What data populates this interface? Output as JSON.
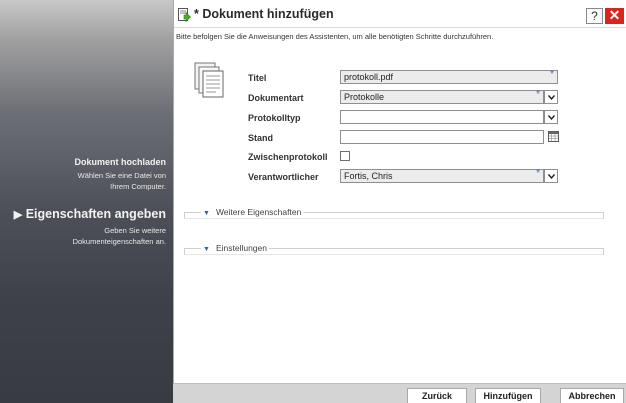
{
  "sidebar": {
    "steps": [
      {
        "title": "Dokument hochladen",
        "desc_line1": "Wählen Sie eine Datei von",
        "desc_line2": "Ihrem Computer."
      },
      {
        "arrow": "▶",
        "title": "Eigenschaften angeben",
        "desc_line1": "Geben Sie weitere",
        "desc_line2": "Dokumenteigenschaften an."
      }
    ]
  },
  "dialog": {
    "title": "* Dokument hinzufügen",
    "help_label": "?",
    "close_label": "✕",
    "instructions": "Bitte befolgen Sie die Anweisungen des Assistenten, um alle benötigten Schritte durchzuführen."
  },
  "form": {
    "titel": {
      "label": "Titel",
      "value": "protokoll.pdf",
      "required": "*"
    },
    "dokumentart": {
      "label": "Dokumentart",
      "value": "Protokolle",
      "required": "*"
    },
    "protokolltyp": {
      "label": "Protokolltyp",
      "value": ""
    },
    "stand": {
      "label": "Stand",
      "value": ""
    },
    "zwischenprotokoll": {
      "label": "Zwischenprotokoll",
      "checked": false
    },
    "verantwortlicher": {
      "label": "Verantwortlicher",
      "value": "Fortis, Chris",
      "required": "*"
    }
  },
  "sections": [
    {
      "label": "Weitere Eigenschaften",
      "icon": "triangle-down-icon"
    },
    {
      "label": "Einstellungen",
      "icon": "triangle-down-icon"
    }
  ],
  "footer": {
    "back_label": "Zurück",
    "add_label": "Hinzufügen",
    "cancel_label": "Abbrechen"
  },
  "colors": {
    "close_button": "#d9261c",
    "required_marker": "#3a6fb0",
    "section_toggle": "#2e63a6"
  }
}
